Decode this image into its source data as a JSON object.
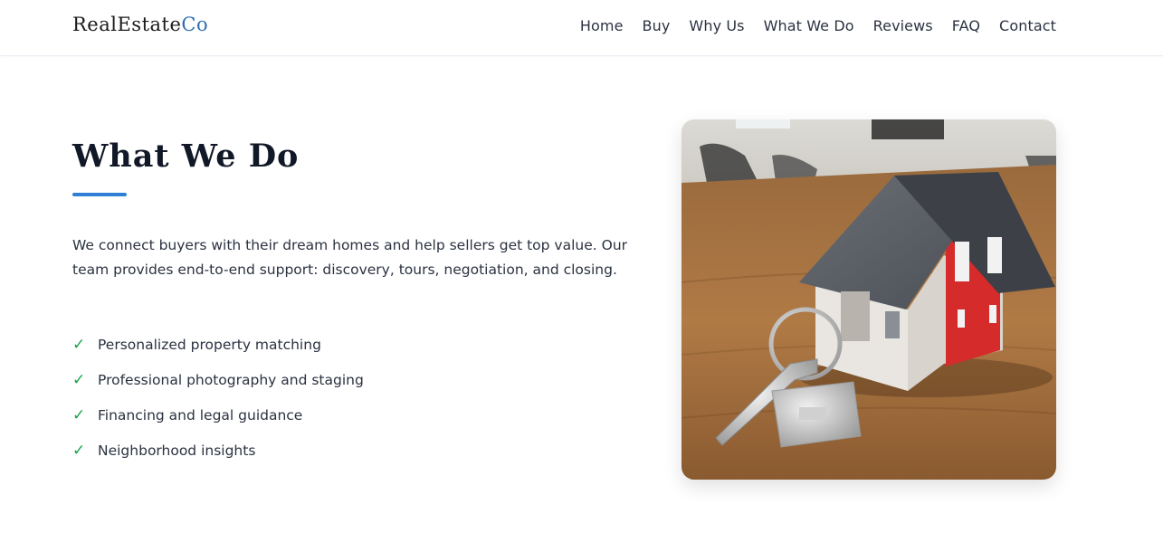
{
  "brand": {
    "name": "RealEstate",
    "accent": "Co"
  },
  "nav": {
    "items": [
      "Home",
      "Buy",
      "Why Us",
      "What We Do",
      "Reviews",
      "FAQ",
      "Contact"
    ]
  },
  "section": {
    "title": "What We Do",
    "intro": "We connect buyers with their dream homes and help sellers get top value. Our team provides end-to-end support: discovery, tours, negotiation, and closing.",
    "features": [
      "Personalized property matching",
      "Professional photography and staging",
      "Financing and legal guidance",
      "Neighborhood insights"
    ],
    "check_glyph": "✓"
  },
  "colors": {
    "brand_accent": "#2f6fb0",
    "underline": "#2f7fd6",
    "check": "#16a34a",
    "text": "#2b3240"
  }
}
